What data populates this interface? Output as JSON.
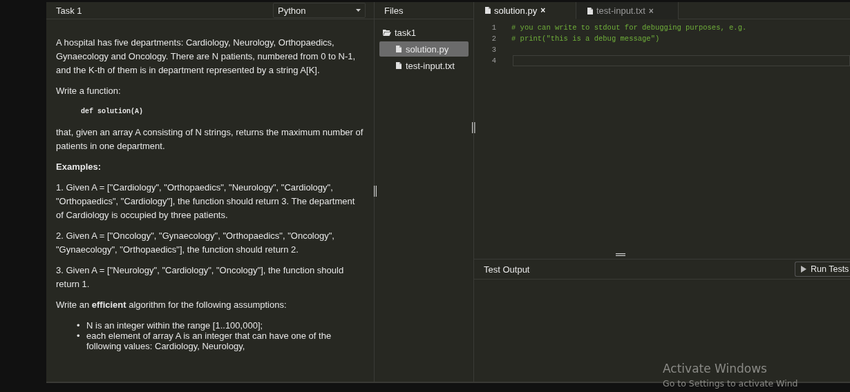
{
  "task_panel": {
    "title": "Task 1",
    "language_select": "Python",
    "statement": [
      {
        "kind": "paragraph",
        "text": "A hospital has five departments: Cardiology, Neurology, Orthopaedics, Gynaecology and Oncology. There are N patients, numbered from 0 to N-1, and the K-th of them is in department represented by a string A[K]."
      },
      {
        "kind": "paragraph",
        "text": "Write a function:"
      },
      {
        "kind": "code",
        "text": "def solution(A)"
      },
      {
        "kind": "paragraph",
        "text": "that, given an array A consisting of N strings, returns the maximum number of patients in one department."
      },
      {
        "kind": "heading",
        "text": "Examples:"
      },
      {
        "kind": "paragraph",
        "text": "1. Given A = [\"Cardiology\", \"Orthopaedics\", \"Neurology\", \"Cardiology\", \"Orthopaedics\", \"Cardiology\"], the function should return 3. The department of Cardiology is occupied by three patients."
      },
      {
        "kind": "paragraph",
        "text": "2. Given A = [\"Oncology\", \"Gynaecology\", \"Orthopaedics\", \"Oncology\", \"Gynaecology\", \"Orthopaedics\"], the function should return 2."
      },
      {
        "kind": "paragraph",
        "text": "3. Given A = [\"Neurology\", \"Cardiology\", \"Oncology\"], the function should return 1."
      },
      {
        "kind": "paragraph",
        "text": "Write an **efficient** algorithm for the following assumptions:"
      },
      {
        "kind": "list",
        "bullet": "•",
        "items": [
          "N is an integer within the range [1..100,000];",
          "each element of array A is an integer that can have one of the following values: Cardiology, Neurology,"
        ]
      }
    ]
  },
  "files": {
    "title": "Files",
    "tree": [
      {
        "name": "task1",
        "kind": "folder",
        "children": [
          {
            "name": "solution.py",
            "kind": "file",
            "selected": true
          },
          {
            "name": "test-input.txt",
            "kind": "file",
            "selected": false
          }
        ]
      }
    ]
  },
  "editor": {
    "tabs": [
      {
        "label": "solution.py",
        "close": "×",
        "selected": true
      },
      {
        "label": "test-input.txt",
        "close": "×",
        "selected": false
      }
    ],
    "lines": [
      {
        "number": "1",
        "text": "# you can write to stdout for debugging purposes, e.g."
      },
      {
        "number": "2",
        "text": "# print(\"this is a debug message\")"
      },
      {
        "number": "3"
      }
    ],
    "active_line": {
      "number": "4"
    }
  },
  "test_output": {
    "title": "Test Output",
    "run_button": "Run Tests"
  },
  "activation_notice": {
    "title": "Activate Windows",
    "subtitle": "Go to Settings to activate Wind"
  }
}
